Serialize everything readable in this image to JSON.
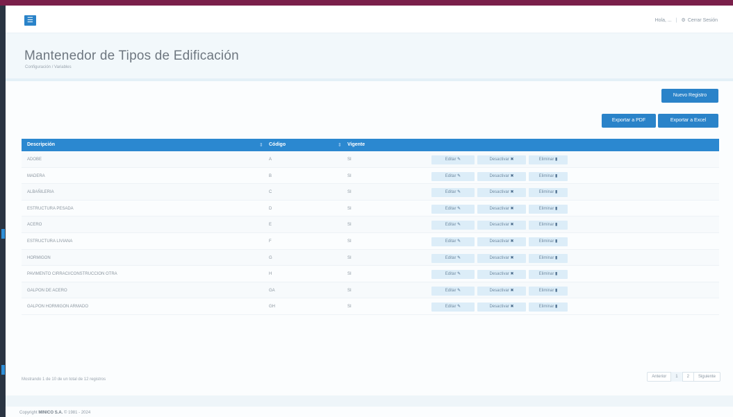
{
  "topbar": {
    "menu_icon": "bars-icon",
    "user_label": "Hola, ...",
    "logout_label": "Cerrar Sesión"
  },
  "header": {
    "title": "Mantenedor de Tipos de Edificación",
    "subtitle": "Configuración / Variables"
  },
  "toolbar": {
    "new_label": "Nuevo Registro",
    "pdf_label": "Exportar a PDF",
    "excel_label": "Exportar a Excel"
  },
  "table": {
    "columns": [
      "Descripción",
      "Código",
      "Vigente"
    ],
    "rows": [
      {
        "descripcion": "ADOBE",
        "codigo": "A",
        "vigente": "SI"
      },
      {
        "descripcion": "MADERA",
        "codigo": "B",
        "vigente": "SI"
      },
      {
        "descripcion": "ALBAÑILERIA",
        "codigo": "C",
        "vigente": "SI"
      },
      {
        "descripcion": "ESTRUCTURA PESADA",
        "codigo": "D",
        "vigente": "SI"
      },
      {
        "descripcion": "ACERO",
        "codigo": "E",
        "vigente": "SI"
      },
      {
        "descripcion": "ESTRUCTURA LIVIANA",
        "codigo": "F",
        "vigente": "SI"
      },
      {
        "descripcion": "HORMIGON",
        "codigo": "G",
        "vigente": "SI"
      },
      {
        "descripcion": "PAVIMENTO CIRRACI/CONSTRUCCION OTRA",
        "codigo": "H",
        "vigente": "SI"
      },
      {
        "descripcion": "GALPON DE ACERO",
        "codigo": "GA",
        "vigente": "SI"
      },
      {
        "descripcion": "GALPON HORMIGON ARMADO",
        "codigo": "GH",
        "vigente": "SI"
      }
    ],
    "actions": {
      "edit_label": "Editar",
      "deactivate_label": "Desactivar",
      "delete_label": "Eliminar"
    }
  },
  "footer": {
    "info": "Mostrando 1 de 10 de un total de 12 registros",
    "pager": {
      "prev": "Anterior",
      "pages": [
        "1",
        "2"
      ],
      "next": "Siguiente"
    },
    "copyright_prefix": "Copyright",
    "copyright_brand": "MINICO S.A.",
    "copyright_suffix": "© 1981 - 2024"
  }
}
